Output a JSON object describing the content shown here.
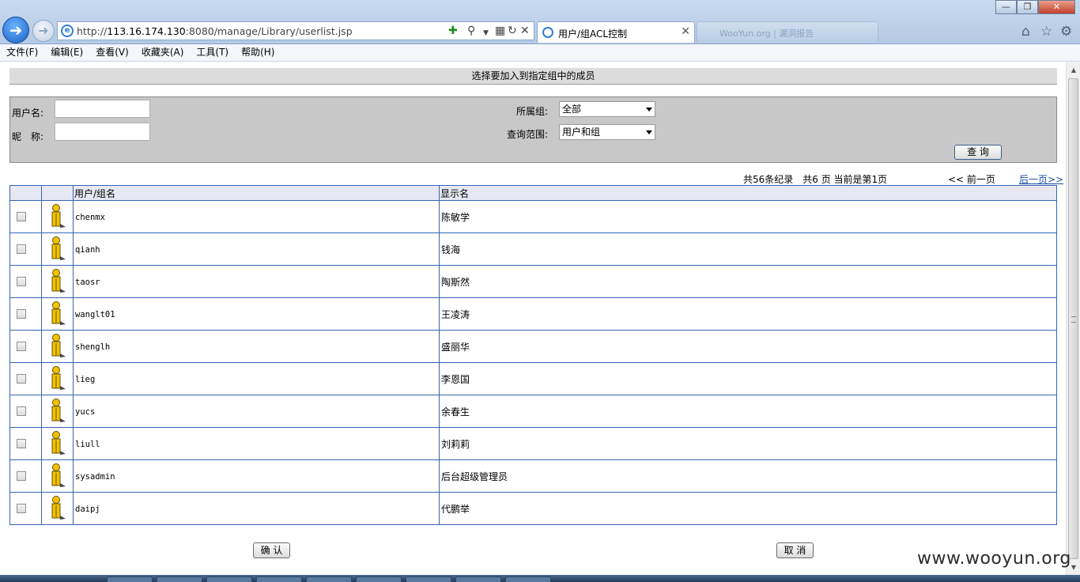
{
  "browser": {
    "url_prefix": "http://",
    "url_host": "113.16.174.130",
    "url_rest": ":8080/manage/Library/userlist.jsp",
    "active_tab_title": "用户/组ACL控制",
    "inactive_tab_title": "WooYun.org | 漏洞报告"
  },
  "menu": [
    "文件(F)",
    "编辑(E)",
    "查看(V)",
    "收藏夹(A)",
    "工具(T)",
    "帮助(H)"
  ],
  "page_title": "选择要加入到指定组中的成员",
  "search": {
    "username_label": "用户名:",
    "nickname_label": "昵　称:",
    "group_label": "所属组:",
    "group_value": "全部",
    "scope_label": "查询范围:",
    "scope_value": "用户和组",
    "query_button": "查 询"
  },
  "pager": {
    "info": "共56条纪录　共6 页 当前是第1页",
    "prev": "<< 前一页",
    "next": "后一页>>"
  },
  "table": {
    "header_name": "用户/组名",
    "header_display": "显示名",
    "rows": [
      {
        "name": "chenmx",
        "display": "陈敏学"
      },
      {
        "name": "qianh",
        "display": "钱海"
      },
      {
        "name": "taosr",
        "display": "陶斯然"
      },
      {
        "name": "wanglt01",
        "display": "王凌涛"
      },
      {
        "name": "shenglh",
        "display": "盛丽华"
      },
      {
        "name": "lieg",
        "display": "李恩国"
      },
      {
        "name": "yucs",
        "display": "余春生"
      },
      {
        "name": "liull",
        "display": "刘莉莉"
      },
      {
        "name": "sysadmin",
        "display": "后台超级管理员"
      },
      {
        "name": "daipj",
        "display": "代鹏举"
      }
    ]
  },
  "buttons": {
    "ok": "确 认",
    "cancel": "取 消"
  },
  "watermark": "www.wooyun.org"
}
